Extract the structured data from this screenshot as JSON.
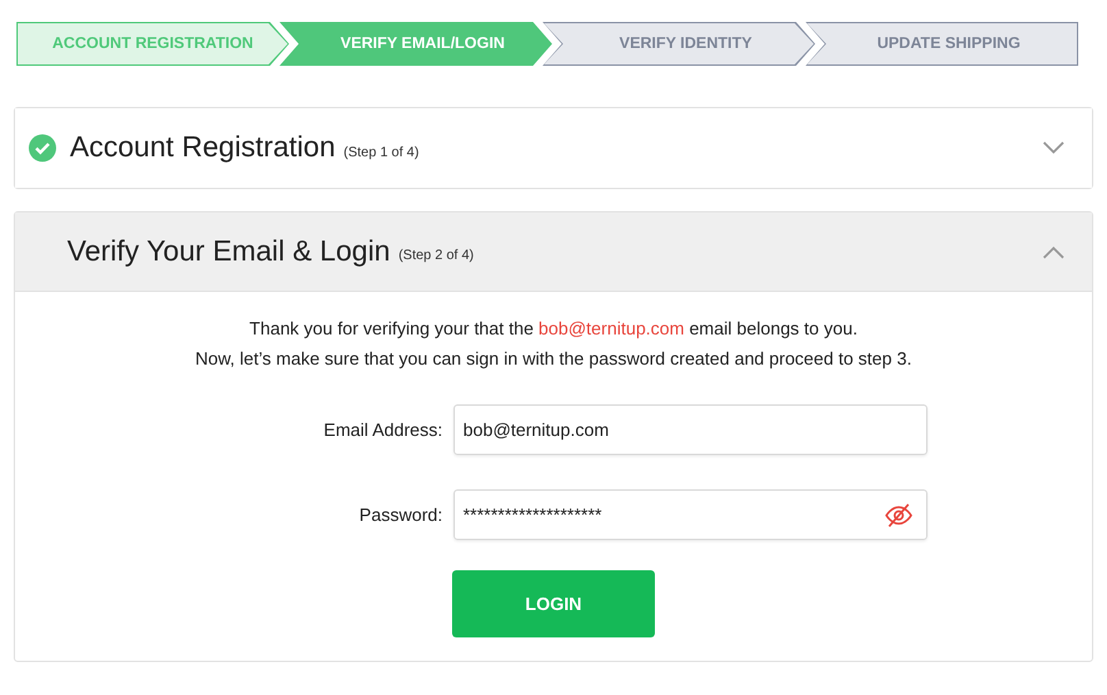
{
  "steps": [
    {
      "label": "ACCOUNT REGISTRATION",
      "kind": "done"
    },
    {
      "label": "VERIFY EMAIL/LOGIN",
      "kind": "current"
    },
    {
      "label": "VERIFY IDENTITY",
      "kind": "upcoming"
    },
    {
      "label": "UPDATE SHIPPING",
      "kind": "upcoming"
    }
  ],
  "sections": [
    {
      "title": "Account Registration",
      "step": "(Step 1 of 4)",
      "completed": true,
      "expanded": false
    },
    {
      "title": "Verify Your Email & Login",
      "step": "(Step 2 of 4)",
      "completed": false,
      "expanded": true
    }
  ],
  "message": [
    [
      {
        "kind": "plain",
        "text": "Thank you for verifying your that the "
      },
      {
        "kind": "highlight",
        "text": "bob@ternitup.com"
      },
      {
        "kind": "plain",
        "text": " email belongs to you."
      }
    ],
    [
      {
        "kind": "plain",
        "text": "Now, let’s make sure that you can sign in with the password created and proceed to step 3."
      }
    ]
  ],
  "form": {
    "email_label": "Email Address:",
    "email_value": "bob@ternitup.com",
    "password_label": "Password:",
    "password_value": "********************"
  },
  "login_button": "LOGIN"
}
